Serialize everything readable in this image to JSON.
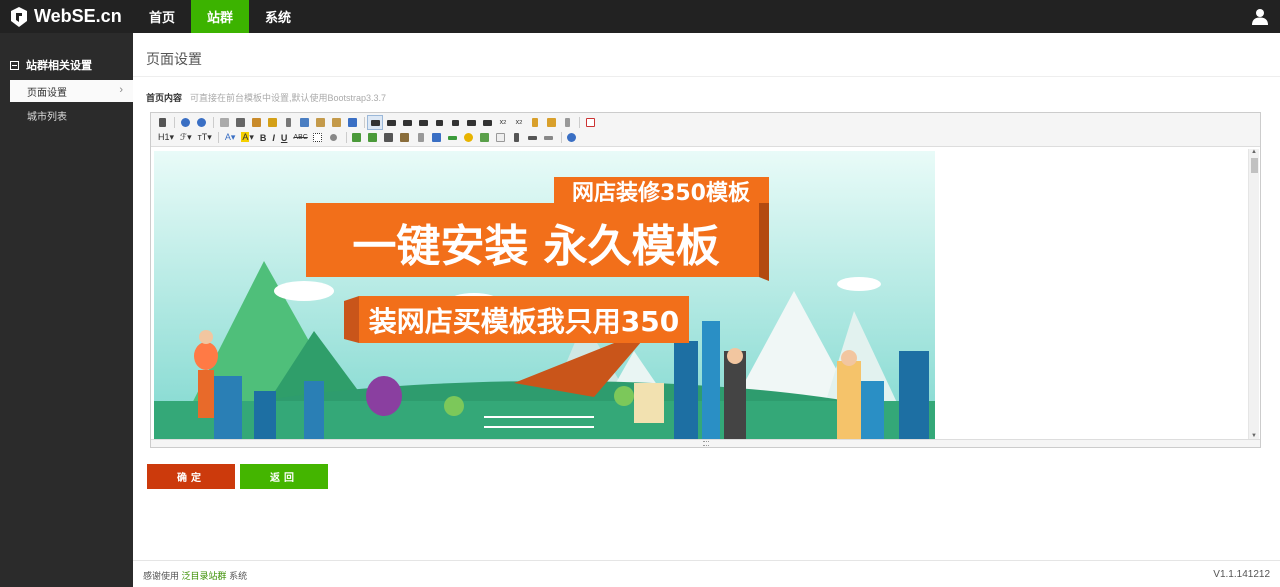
{
  "brand": {
    "name": "WebSE.cn"
  },
  "nav": {
    "items": [
      "首页",
      "站群",
      "系统"
    ],
    "active_index": 1
  },
  "sidebar": {
    "group_label": "站群相关设置",
    "items": [
      {
        "label": "页面设置",
        "active": true
      },
      {
        "label": "城市列表",
        "active": false
      }
    ]
  },
  "main": {
    "page_title": "页面设置",
    "field_label": "首页内容",
    "field_hint": "可直接在前台模板中设置,默认使用Bootstrap3.3.7"
  },
  "toolbar": {
    "heading": "H1",
    "font_family": "ℱ",
    "font_size": "тT",
    "font_color": "A",
    "bg_color": "A",
    "bold": "B",
    "italic": "I",
    "underline": "U",
    "strike": "ABC"
  },
  "banner": {
    "tag": "网店装修350模板",
    "headline": "一键安装 永久模板",
    "subline": "装网店买模板我只用350"
  },
  "buttons": {
    "ok": "确定",
    "back": "返回"
  },
  "footer": {
    "prefix": "感谢使用",
    "link": "泛目录站群",
    "suffix": "系统",
    "version": "V1.1.141212"
  },
  "colors": {
    "nav_bg": "#222222",
    "nav_active": "#3cb300",
    "sidebar_bg": "#2b2b2b",
    "ok": "#cc3a0c",
    "back": "#44b500",
    "banner_orange": "#f26f1a"
  }
}
